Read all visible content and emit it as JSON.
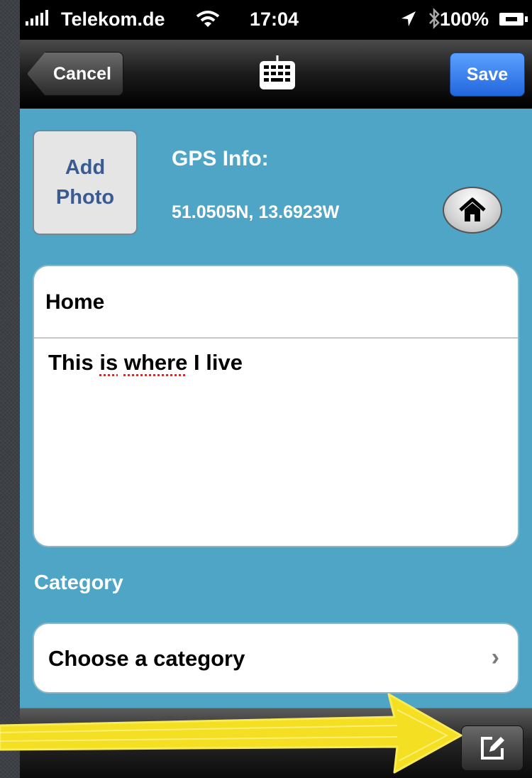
{
  "status_bar": {
    "carrier": "Telekom.de",
    "time": "17:04",
    "battery": "100%",
    "icons": [
      "signal-bars-icon",
      "wifi-icon",
      "location-arrow-icon",
      "bluetooth-icon",
      "battery-charging-icon"
    ]
  },
  "nav": {
    "cancel_label": "Cancel",
    "center_icon": "keyboard-icon",
    "save_label": "Save"
  },
  "form": {
    "add_photo_line1": "Add",
    "add_photo_line2": "Photo",
    "gps_label": "GPS Info:",
    "gps_coords": "51.0505N, 13.6923W",
    "home_icon": "home-icon",
    "note_title": "Home",
    "note_body": {
      "word1": "This ",
      "word2": "is",
      "word3": " ",
      "word4": "where",
      "word5": " I live"
    },
    "category_label": "Category",
    "category_value": "Choose a category",
    "category_chevron": "›"
  },
  "toolbar": {
    "compose_icon": "compose-icon"
  },
  "colors": {
    "content_bg": "#4fa5c6",
    "save_blue": "#2f7bf0",
    "highlight_arrow": "#f7e52c"
  }
}
